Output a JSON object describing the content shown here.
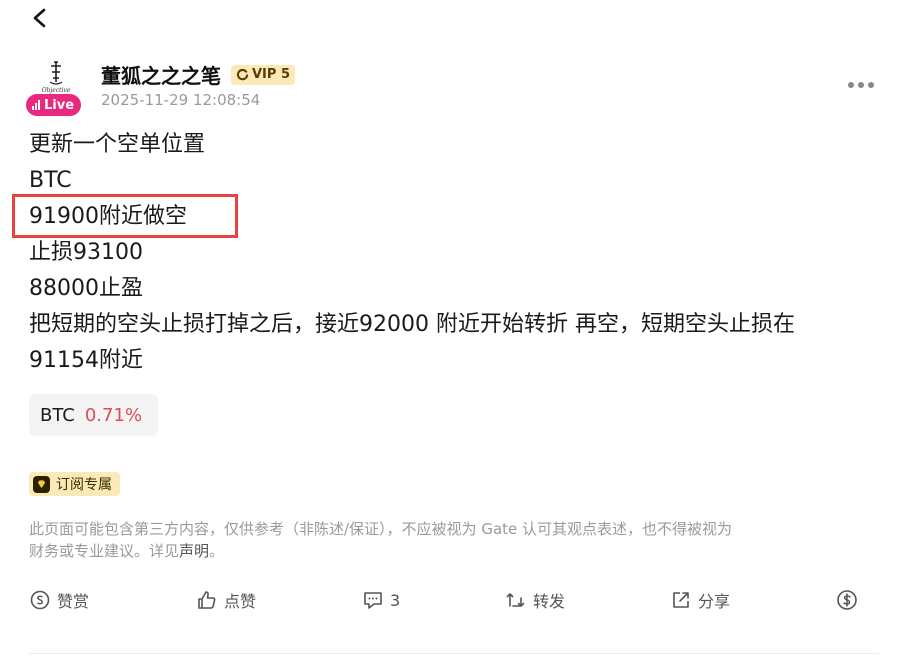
{
  "post": {
    "author": "董狐之之之笔",
    "vip_label": "VIP 5",
    "live_label": "Live",
    "avatar_text": "Objective",
    "timestamp": "2025-11-29 12:08:54",
    "lines": [
      "更新一个空单位置",
      "BTC",
      "91900附近做空",
      "止损93100",
      "88000止盈",
      "把短期的空头止损打掉之后，接近92000 附近开始转折 再空，短期空头止损在",
      "91154附近"
    ]
  },
  "coin": {
    "symbol": "BTC",
    "change": "0.71%",
    "change_color": "#e04a5a"
  },
  "subscription_badge": "订阅专属",
  "disclaimer": {
    "line1": "此页面可能包含第三方内容，仅供参考（非陈述/保证），不应被视为 Gate 认可其观点表述，也不得被视为",
    "line2_prefix": "财务或专业建议。详见",
    "link": "声明",
    "line2_suffix": "。"
  },
  "actions": {
    "tip": "赞赏",
    "like": "点赞",
    "comments_count": "3",
    "repost": "转发",
    "share": "分享"
  },
  "icons": {
    "back": "chevron-left-icon",
    "more": "more-dots-icon",
    "tip": "coin-icon",
    "like": "thumbs-up-icon",
    "comment": "comment-icon",
    "repost": "repost-icon",
    "share": "share-icon",
    "dollar": "dollar-icon"
  },
  "colors": {
    "live": "#e8297f",
    "vip_bg": "#fbe9b7",
    "highlight_box": "#e8403f"
  }
}
